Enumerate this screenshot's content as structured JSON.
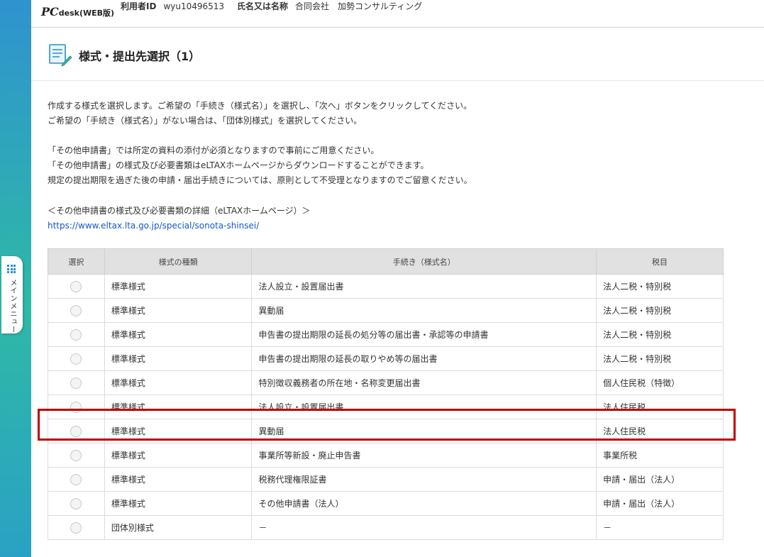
{
  "menu": {
    "label": "メインメニュー"
  },
  "header": {
    "logo_main": "PC",
    "logo_sub": "desk",
    "logo_edition": "(WEB版)",
    "user_id_label": "利用者ID",
    "user_id_value": "wyu10496513",
    "name_label": "氏名又は名称",
    "name_value": "合同会社　加勢コンサルティング"
  },
  "page": {
    "title": "様式・提出先選択（1）"
  },
  "instructions": {
    "line1": "作成する様式を選択します。ご希望の「手続き（様式名）」を選択し、「次へ」ボタンをクリックしてください。",
    "line2": "ご希望の「手続き（様式名）」がない場合は、「団体別様式」を選択してください。",
    "line3": "「その他申請書」では所定の資料の添付が必須となりますので事前にご用意ください。",
    "line4": "「その他申請書」の様式及び必要書類はeLTAXホームページからダウンロードすることができます。",
    "line5": "規定の提出期限を過ぎた後の申請・届出手続きについては、原則として不受理となりますのでご留意ください。",
    "link_heading": "＜その他申請書の様式及び必要書類の詳細（eLTAXホームページ）＞",
    "link_url": "https://www.eltax.lta.go.jp/special/sonota-shinsei/"
  },
  "table": {
    "headers": {
      "select": "選択",
      "type": "様式の種類",
      "procedure": "手続き（様式名）",
      "tax": "税目"
    },
    "rows": [
      {
        "type": "標準様式",
        "procedure": "法人設立・設置届出書",
        "tax": "法人二税・特別税"
      },
      {
        "type": "標準様式",
        "procedure": "異動届",
        "tax": "法人二税・特別税"
      },
      {
        "type": "標準様式",
        "procedure": "申告書の提出期限の延長の処分等の届出書・承認等の申請書",
        "tax": "法人二税・特別税"
      },
      {
        "type": "標準様式",
        "procedure": "申告書の提出期限の延長の取りやめ等の届出書",
        "tax": "法人二税・特別税"
      },
      {
        "type": "標準様式",
        "procedure": "特別徴収義務者の所在地・名称変更届出書",
        "tax": "個人住民税（特徴）"
      },
      {
        "type": "標準様式",
        "procedure": "法人設立・設置届出書",
        "tax": "法人住民税"
      },
      {
        "type": "標準様式",
        "procedure": "異動届",
        "tax": "法人住民税"
      },
      {
        "type": "標準様式",
        "procedure": "事業所等新設・廃止申告書",
        "tax": "事業所税"
      },
      {
        "type": "標準様式",
        "procedure": "税務代理権限証書",
        "tax": "申請・届出（法人）"
      },
      {
        "type": "標準様式",
        "procedure": "その他申請書（法人）",
        "tax": "申請・届出（法人）"
      },
      {
        "type": "団体別様式",
        "procedure": "－",
        "tax": "－"
      }
    ]
  },
  "colors": {
    "highlight": "#c00000",
    "link": "#1a56c7",
    "strip": "#2fb9a6"
  }
}
